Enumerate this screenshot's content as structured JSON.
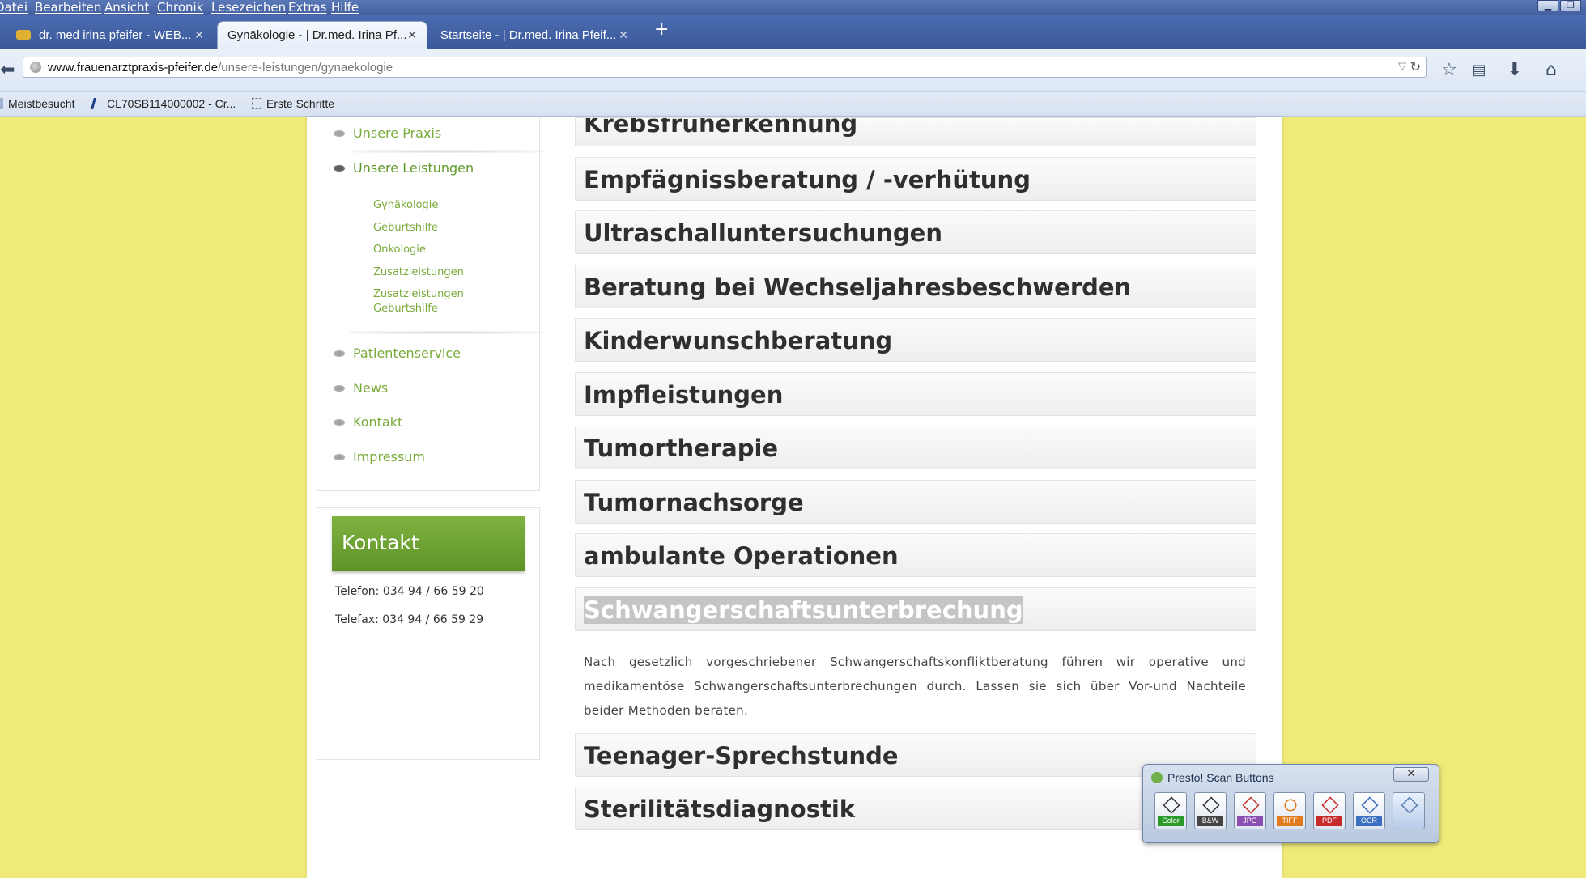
{
  "menubar": {
    "items": [
      "Datei",
      "Bearbeiten",
      "Ansicht",
      "Chronik",
      "Lesezeichen",
      "Extras",
      "Hilfe"
    ]
  },
  "tabs": [
    {
      "label": "dr. med irina pfeifer - WEB...",
      "active": false
    },
    {
      "label": "Gynäkologie - | Dr.med. Irina Pf...",
      "active": true
    },
    {
      "label": "Startseite - | Dr.med. Irina Pfeif...",
      "active": false
    }
  ],
  "newtab_symbol": "+",
  "address": {
    "domain": "www.frauenarztpraxis-pfeifer.de",
    "path": "/unsere-leistungen/gynaekologie"
  },
  "bookmarks": [
    "Meistbesucht",
    "CL70SB114000002 - Cr...",
    "Erste Schritte"
  ],
  "sidebar": {
    "items_top": [
      "Unsere Praxis",
      "Unsere Leistungen"
    ],
    "subitems": [
      "Gynäkologie",
      "Geburtshilfe",
      "Onkologie",
      "Zusatzleistungen",
      "Zusatzleistungen",
      "Geburtshilfe"
    ],
    "items_bottom": [
      "Patientenservice",
      "News",
      "Kontakt",
      "Impressum"
    ]
  },
  "contact": {
    "heading": "Kontakt",
    "phone": "Telefon: 034 94 / 66 59 20",
    "fax": "Telefax: 034 94 / 66 59 29"
  },
  "accordion": {
    "clipped_title": "Krebsfrüherkennung",
    "headings": [
      "Empfägnissberatung / -verhütung",
      "Ultraschalluntersuchungen",
      "Beratung bei Wechseljahresbeschwerden",
      "Kinderwunschberatung",
      "Impfleistungen",
      "Tumortherapie",
      "Tumornachsorge",
      "ambulante Operationen",
      "Schwangerschaftsunterbrechung"
    ],
    "open_body": "Nach gesetzlich vorgeschriebener Schwangerschaftskonfliktberatung führen wir operative und medikamentöse Schwangerschaftsunterbrechungen durch. Lassen sie sich über Vor-und Nachteile beider Methoden beraten.",
    "headings_after": [
      "Teenager-Sprechstunde",
      "Sterilitätsdiagnostik"
    ]
  },
  "presto": {
    "title": "Presto! Scan Buttons",
    "buttons": [
      {
        "label": "Color",
        "color": "#2a9a2a"
      },
      {
        "label": "B&W",
        "color": "#444444"
      },
      {
        "label": "JPG",
        "color": "#8a4fb0"
      },
      {
        "label": "TIFF",
        "color": "#e07a1e"
      },
      {
        "label": "PDF",
        "color": "#c72a2a"
      },
      {
        "label": "OCR",
        "color": "#3a6fc2"
      },
      {
        "label": "",
        "color": "#5a7fb0"
      }
    ]
  }
}
